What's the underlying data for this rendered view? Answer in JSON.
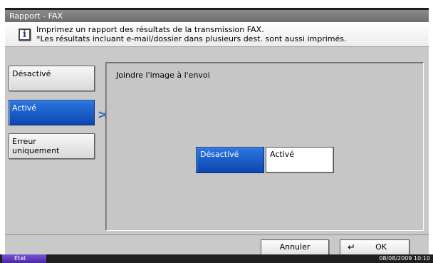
{
  "window": {
    "title": "Rapport - FAX"
  },
  "info": {
    "icon": "info-icon",
    "line1": "Imprimez un rapport des résultats de la transmission FAX.",
    "line2": "*Les résultats incluant e-mail/dossier dans plusieurs dest. sont aussi imprimés."
  },
  "left_options": [
    {
      "label": "Désactivé",
      "selected": false
    },
    {
      "label": "Activé",
      "selected": true
    },
    {
      "label": "Erreur\nuniquement",
      "selected": false
    }
  ],
  "panel": {
    "title": "Joindre l'image à l'envoi",
    "options": [
      {
        "label": "Désactivé",
        "selected": true
      },
      {
        "label": "Activé",
        "selected": false
      }
    ]
  },
  "actions": {
    "cancel_label": "Annuler",
    "ok_label": "OK"
  },
  "status": {
    "state_label": "État",
    "datetime": "08/08/2009   10:10"
  },
  "colors": {
    "accent_blue": "#1a5fd0",
    "screen_gray": "#c9c9c9",
    "status_purple": "#5a36b8"
  }
}
